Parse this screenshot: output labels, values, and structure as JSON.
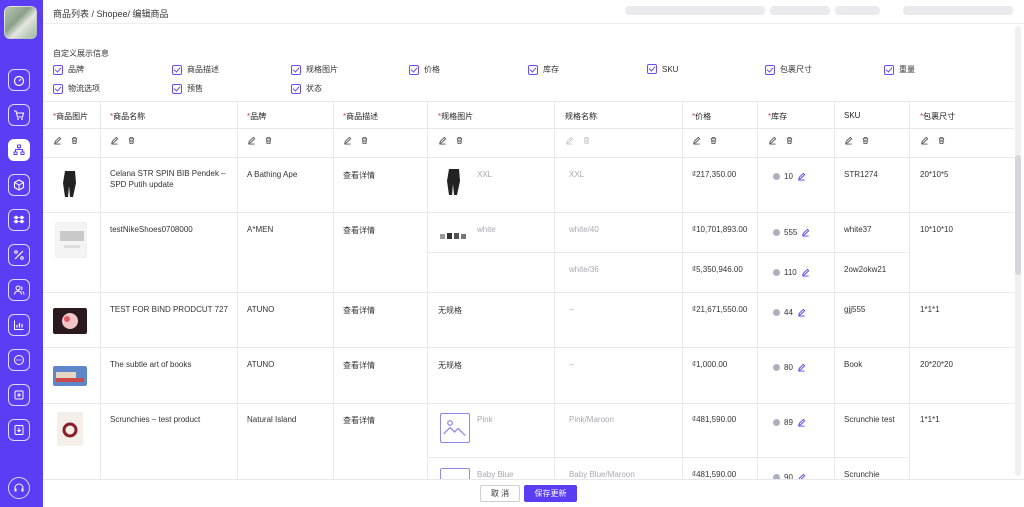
{
  "breadcrumb": "商品列表 / Shopee/ 编辑商品",
  "options": {
    "title": "自定义展示信息",
    "items": [
      "品牌",
      "商品描述",
      "规格图片",
      "价格",
      "库存",
      "SKU",
      "包裹尺寸",
      "重量",
      "物流选项",
      "预售",
      "状态"
    ]
  },
  "columns": [
    "商品图片",
    "商品名称",
    "品牌",
    "商品描述",
    "规格图片",
    "规格名称",
    "价格",
    "库存",
    "SKU",
    "包裹尺寸"
  ],
  "rows": [
    {
      "name": "Celana STR SPIN BIB Pendek – SPD Putih update",
      "brand": "A Bathing Ape",
      "desc": "查看详情",
      "spec_img_label": "XXL",
      "spec_name": "XXL",
      "price": "₫217,350.00",
      "stock": "10",
      "sku": "STR1274",
      "size": "20*10*5"
    },
    {
      "name": "testNikeShoes0708000",
      "brand": "A*MEN",
      "desc": "查看详情",
      "spec_img_label": "white",
      "spec_name": "white/40",
      "price": "₫10,701,893.00",
      "stock": "555",
      "sku": "white37",
      "size": "10*10*10",
      "spec_name2": "white/36",
      "price2": "₫5,350,946.00",
      "stock2": "110",
      "sku2": "2ow2okw21"
    },
    {
      "name": "TEST FOR BIND PRODCUT 727",
      "brand": "ATUNO",
      "desc": "查看详情",
      "spec_img_label": "无规格",
      "spec_name": "–",
      "price": "₫21,671,550.00",
      "stock": "44",
      "sku": "gjj555",
      "size": "1*1*1"
    },
    {
      "name": "The subtle art of books",
      "brand": "ATUNO",
      "desc": "查看详情",
      "spec_img_label": "无规格",
      "spec_name": "–",
      "price": "₫1,000.00",
      "stock": "80",
      "sku": "Book",
      "size": "20*20*20"
    },
    {
      "name": "Scrunchies – test product",
      "brand": "Natural Island",
      "desc": "查看详情",
      "spec_img_label": "Pink",
      "spec_name": "Pink/Maroon",
      "price": "₫481,590.00",
      "stock": "89",
      "sku": "Scrunchie test",
      "size": "1*1*1",
      "spec_img_label2": "Baby Blue",
      "spec_name2": "Baby Blue/Maroon",
      "price2": "₫481,590.00",
      "stock2": "90",
      "sku2": "Scrunchie"
    }
  ],
  "footer": {
    "cancel": "取 消",
    "save": "保存更新"
  },
  "colors": {
    "accent": "#5b3df5",
    "required": "#e03a3a"
  },
  "icons": {
    "edit": "pencil-icon",
    "delete": "trash-icon"
  }
}
